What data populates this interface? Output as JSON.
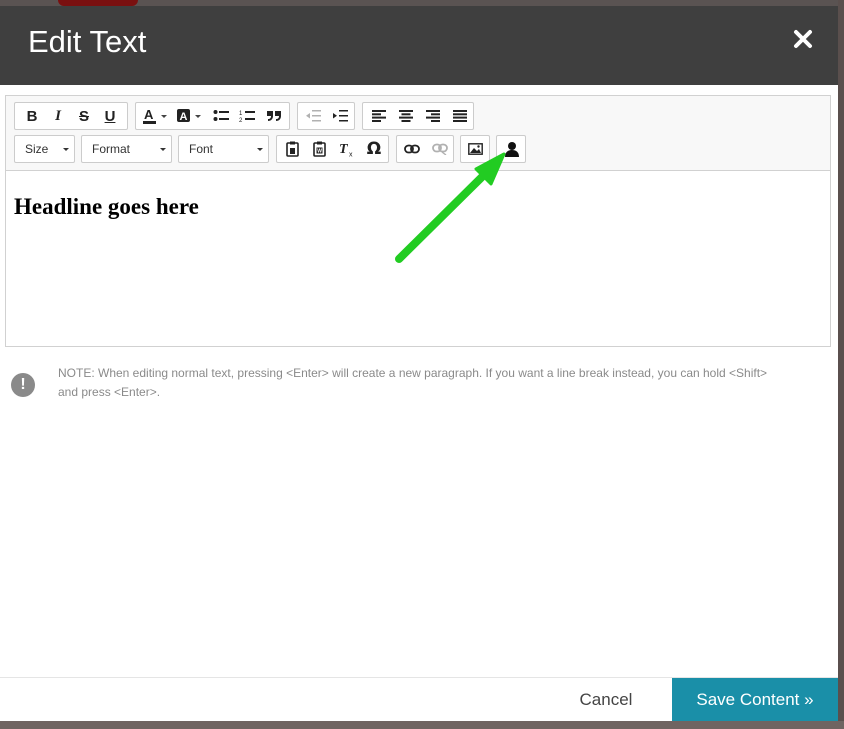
{
  "dialog": {
    "title": "Edit Text",
    "close_icon": "close-icon"
  },
  "toolbar": {
    "row1": {
      "formatting": [
        "bold-icon",
        "italic-icon",
        "strikethrough-icon",
        "underline-icon"
      ],
      "color": [
        "text-color-icon",
        "background-color-icon",
        "bulleted-list-icon",
        "numbered-list-icon",
        "blockquote-icon"
      ],
      "indent": [
        "decrease-indent-icon",
        "increase-indent-icon"
      ],
      "alignment": [
        "align-left-icon",
        "align-center-icon",
        "align-right-icon",
        "justify-icon"
      ]
    },
    "row2": {
      "size_label": "Size",
      "format_label": "Format",
      "font_label": "Font",
      "clipboard": [
        "paste-icon",
        "paste-from-word-icon",
        "remove-format-icon",
        "special-character-icon"
      ],
      "links": [
        "link-icon",
        "unlink-icon"
      ],
      "media": [
        "image-icon",
        "person-icon"
      ]
    }
  },
  "editor": {
    "headline": "Headline goes here"
  },
  "note": {
    "icon": "exclamation-icon",
    "icon_glyph": "!",
    "text": "NOTE: When editing normal text, pressing <Enter> will create a new paragraph. If you want a line break instead, you can hold <Shift> and press <Enter>."
  },
  "annotation": {
    "arrow_color": "#22cc22"
  },
  "footer": {
    "cancel_label": "Cancel",
    "save_label": "Save Content »"
  },
  "colors": {
    "header_bg": "#3f3f3f",
    "save_bg": "#1a8fa8"
  }
}
